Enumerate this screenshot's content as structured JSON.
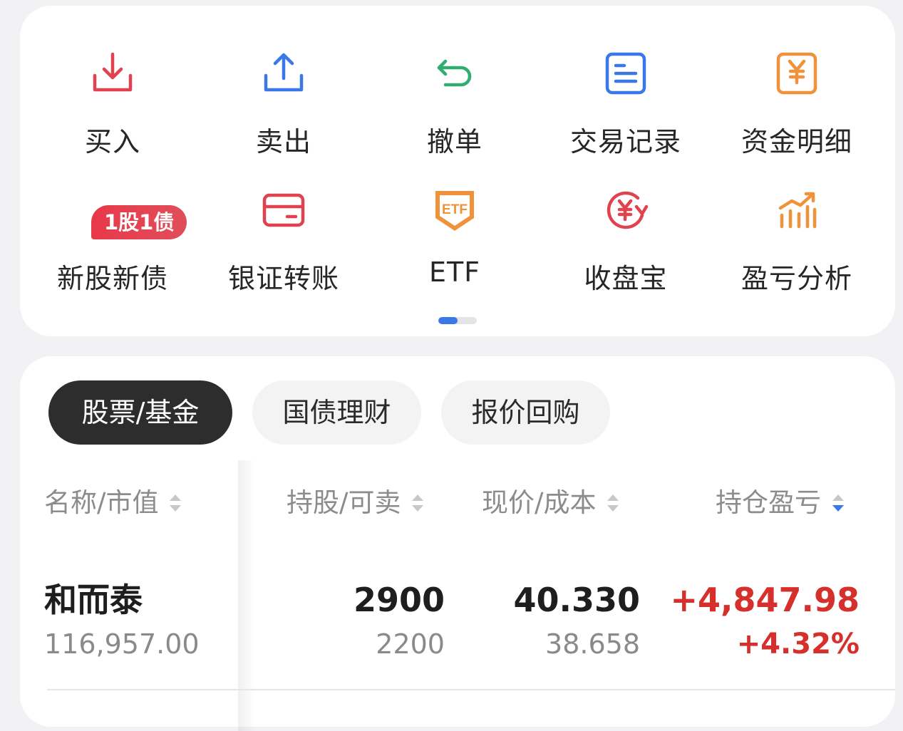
{
  "quick_actions": {
    "row1": [
      {
        "label": "买入",
        "icon": "download-tray-icon",
        "color": "#e0424f"
      },
      {
        "label": "卖出",
        "icon": "upload-tray-icon",
        "color": "#3b78e7"
      },
      {
        "label": "撤单",
        "icon": "undo-arrow-icon",
        "color": "#2fae6f"
      },
      {
        "label": "交易记录",
        "icon": "document-list-icon",
        "color": "#3b78e7"
      },
      {
        "label": "资金明细",
        "icon": "yuan-receipt-icon",
        "color": "#f0923a"
      }
    ],
    "row2": [
      {
        "label": "新股新债",
        "icon": "new-ipo-badge-icon",
        "badge": "1股1债"
      },
      {
        "label": "银证转账",
        "icon": "bank-card-icon",
        "color": "#e0424f"
      },
      {
        "label": "ETF",
        "icon": "etf-shield-icon",
        "color": "#f0923a"
      },
      {
        "label": "收盘宝",
        "icon": "yuan-refresh-icon",
        "color": "#e0424f"
      },
      {
        "label": "盈亏分析",
        "icon": "bar-chart-trend-icon",
        "color": "#f0923a"
      }
    ],
    "page_indicator": {
      "current": 1,
      "total": 2
    }
  },
  "holdings": {
    "tabs": [
      {
        "label": "股票/基金",
        "active": true
      },
      {
        "label": "国债理财",
        "active": false
      },
      {
        "label": "报价回购",
        "active": false
      }
    ],
    "columns": [
      {
        "label": "名称/市值",
        "sort": "none"
      },
      {
        "label": "持股/可卖",
        "sort": "none"
      },
      {
        "label": "现价/成本",
        "sort": "none"
      },
      {
        "label": "持仓盈亏",
        "sort": "desc"
      }
    ],
    "rows": [
      {
        "name": "和而泰",
        "market_value": "116,957.00",
        "shares": "2900",
        "sellable": "2200",
        "price": "40.330",
        "cost": "38.658",
        "pnl": "+4,847.98",
        "pnl_pct": "+4.32%"
      }
    ]
  },
  "colors": {
    "accent_blue": "#3b78e7",
    "profit_red": "#d5302b",
    "tab_active_bg": "#2d2d2d"
  }
}
